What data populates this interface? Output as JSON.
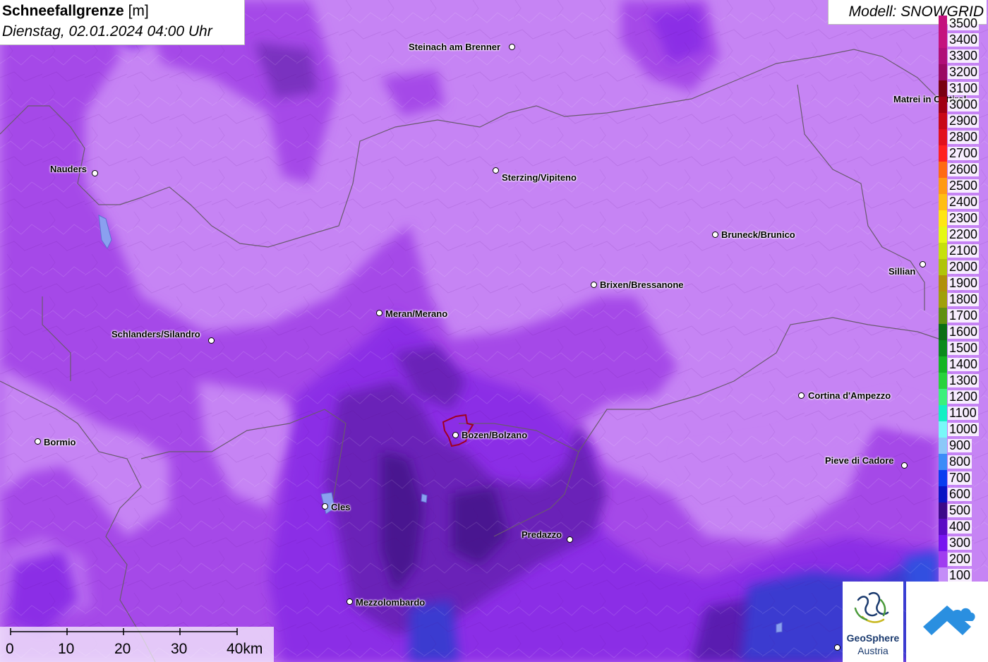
{
  "title": {
    "main": "Schneefallgrenze",
    "unit": "[m]",
    "datetime": "Dienstag, 02.01.2024 04:00 Uhr"
  },
  "model": "Modell: SNOWGRID",
  "legend": [
    {
      "label": "3500",
      "color": "#c4127e"
    },
    {
      "label": "3400",
      "color": "#c4127e"
    },
    {
      "label": "3300",
      "color": "#b00f78"
    },
    {
      "label": "3200",
      "color": "#9a0a62"
    },
    {
      "label": "3100",
      "color": "#7a0012"
    },
    {
      "label": "3000",
      "color": "#a00014"
    },
    {
      "label": "2900",
      "color": "#c80818"
    },
    {
      "label": "2800",
      "color": "#e2101c"
    },
    {
      "label": "2700",
      "color": "#ff2020"
    },
    {
      "label": "2600",
      "color": "#ff6a14"
    },
    {
      "label": "2500",
      "color": "#ff9a14"
    },
    {
      "label": "2400",
      "color": "#ffbe14"
    },
    {
      "label": "2300",
      "color": "#ffe614"
    },
    {
      "label": "2200",
      "color": "#e6f814"
    },
    {
      "label": "2100",
      "color": "#c6e00c"
    },
    {
      "label": "2000",
      "color": "#b0c40a"
    },
    {
      "label": "1900",
      "color": "#b0900a"
    },
    {
      "label": "1800",
      "color": "#a0a00a"
    },
    {
      "label": "1700",
      "color": "#609010"
    },
    {
      "label": "1600",
      "color": "#0a6e14"
    },
    {
      "label": "1500",
      "color": "#0a8a1c"
    },
    {
      "label": "1400",
      "color": "#14b424"
    },
    {
      "label": "1300",
      "color": "#28d23c"
    },
    {
      "label": "1200",
      "color": "#3cf07c"
    },
    {
      "label": "1100",
      "color": "#14f0c4"
    },
    {
      "label": "1000",
      "color": "#78f8f8"
    },
    {
      "label": "900",
      "color": "#8cc8f8"
    },
    {
      "label": "800",
      "color": "#3c8cf8"
    },
    {
      "label": "700",
      "color": "#0a3cf0"
    },
    {
      "label": "600",
      "color": "#0a14c4"
    },
    {
      "label": "500",
      "color": "#3c0a8a"
    },
    {
      "label": "400",
      "color": "#5a0ac4"
    },
    {
      "label": "300",
      "color": "#7814f0"
    },
    {
      "label": "200",
      "color": "#a03cf0"
    },
    {
      "label": "100",
      "color": "#c48cf8"
    }
  ],
  "cities": [
    {
      "name": "Steinach am Brenner"
    },
    {
      "name": "Nauders"
    },
    {
      "name": "Sterzing/Vipiteno"
    },
    {
      "name": "Matrei in Osttirol"
    },
    {
      "name": "Bruneck/Brunico"
    },
    {
      "name": "Sillian"
    },
    {
      "name": "Brixen/Bressanone"
    },
    {
      "name": "Meran/Merano"
    },
    {
      "name": "Schlanders/Silandro"
    },
    {
      "name": "Cortina d'Ampezzo"
    },
    {
      "name": "Bormio"
    },
    {
      "name": "Bozen/Bolzano"
    },
    {
      "name": "Pieve di Cadore"
    },
    {
      "name": "Cles"
    },
    {
      "name": "Predazzo"
    },
    {
      "name": "Mezzolombardo"
    }
  ],
  "scalebar": {
    "labels": [
      "0",
      "10",
      "20",
      "30",
      "40km"
    ]
  },
  "logos": {
    "geosphere_line1": "GeoSphere",
    "geosphere_line2": "Austria"
  }
}
